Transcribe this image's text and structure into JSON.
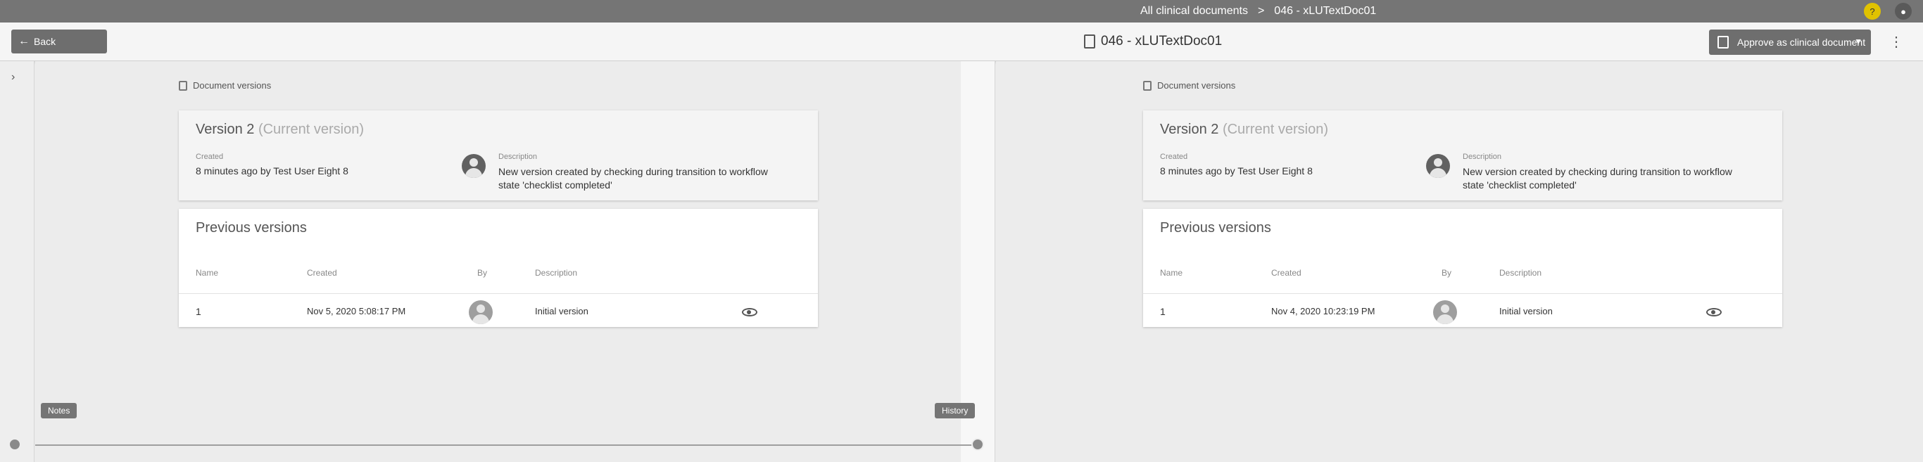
{
  "topbar": {
    "breadcrumb": [
      "All clinical documents",
      "046 - xLUTextDoc01"
    ],
    "separator": ">"
  },
  "toolbar": {
    "back_label": "Back",
    "doc_title": "046 - xLUTextDoc01",
    "approve_label": "Approve as clinical document",
    "more_icon": "⋮"
  },
  "left_panel": {
    "section_label": "Document versions",
    "current": {
      "title": "Version 2",
      "status": "(Current version)",
      "created_label": "Created",
      "created_value": "8 minutes ago by Test User Eight 8",
      "description_label": "Description",
      "description_value": "New version created by checking during transition to workflow state 'checklist completed'"
    },
    "previous": {
      "title": "Previous versions",
      "headers": [
        "Name",
        "Created",
        "By",
        "Description"
      ],
      "rows": [
        {
          "name": "1",
          "created": "Nov 5, 2020 5:08:17 PM",
          "description": "Initial version"
        }
      ]
    }
  },
  "right_panel": {
    "section_label": "Document versions",
    "current": {
      "title": "Version 2",
      "status": "(Current version)",
      "created_label": "Created",
      "created_value": "8 minutes ago by Test User Eight 8",
      "description_label": "Description",
      "description_value": "New version created by checking during transition to workflow state 'checklist completed'"
    },
    "previous": {
      "title": "Previous versions",
      "headers": [
        "Name",
        "Created",
        "By",
        "Description"
      ],
      "rows": [
        {
          "name": "1",
          "created": "Nov 4, 2020 10:23:19 PM",
          "description": "Initial version"
        }
      ]
    }
  },
  "bottom": {
    "left_tab": "Notes",
    "right_tab": "History"
  },
  "colors": {
    "topbar": "#757575",
    "button": "#6e6e6e",
    "background": "#ececec"
  }
}
